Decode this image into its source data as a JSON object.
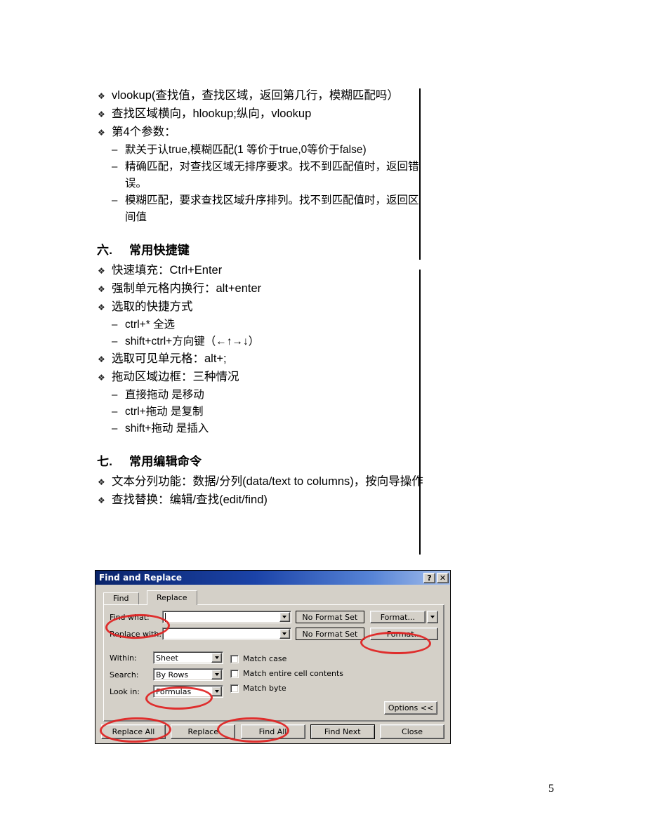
{
  "page": {
    "number": "5"
  },
  "document": {
    "list_top": [
      {
        "bullet": "❖",
        "text": "vlookup(查找值，查找区域，返回第几行，模糊匹配吗）"
      },
      {
        "bullet": "❖",
        "text": "查找区域横向，hlookup;纵向，vlookup"
      },
      {
        "bullet": "❖",
        "text": "第4个参数："
      }
    ],
    "sub_top": [
      {
        "bullet": "–",
        "text": "默关于认true,模糊匹配(1 等价于true,0等价于false)"
      },
      {
        "bullet": "–",
        "text": "精确匹配，对查找区域无排序要求。找不到匹配值时，返回错误。"
      },
      {
        "bullet": "–",
        "text": "模糊匹配，要求查找区域升序排列。找不到匹配值时，返回区间值"
      }
    ],
    "section_six": {
      "number": "六.",
      "title": "常用快捷键"
    },
    "list_six": [
      {
        "bullet": "❖",
        "text": "快速填充：Ctrl+Enter"
      },
      {
        "bullet": "❖",
        "text": "强制单元格内换行：alt+enter"
      },
      {
        "bullet": "❖",
        "text": "选取的快捷方式"
      }
    ],
    "sub_six_a": [
      {
        "bullet": "–",
        "text": "ctrl+*  全选"
      },
      {
        "bullet": "–",
        "text": "shift+ctrl+方向键（←↑→↓）"
      }
    ],
    "list_six_b": [
      {
        "bullet": "❖",
        "text": "选取可见单元格：alt+;"
      },
      {
        "bullet": "❖",
        "text": "拖动区域边框：三种情况"
      }
    ],
    "sub_six_b": [
      {
        "bullet": "–",
        "text": "直接拖动  是移动"
      },
      {
        "bullet": "–",
        "text": "ctrl+拖动  是复制"
      },
      {
        "bullet": "–",
        "text": "shift+拖动  是插入"
      }
    ],
    "section_seven": {
      "number": "七.",
      "title": "常用编辑命令"
    },
    "list_seven": [
      {
        "bullet": "❖",
        "text": "文本分列功能：数据/分列(data/text to columns)，按向导操作"
      },
      {
        "bullet": "❖",
        "text": "查找替换：编辑/查找(edit/find)"
      }
    ]
  },
  "dialog": {
    "title": "Find and Replace",
    "help_button": "?",
    "close_button": "✕",
    "tabs": [
      {
        "label": "Find",
        "active": false
      },
      {
        "label": "Replace",
        "active": true
      }
    ],
    "fields": {
      "find_what_label": "Find what:",
      "find_what_value": "",
      "replace_with_label": "Replace with:",
      "replace_with_value": "",
      "no_format_set_1": "No Format Set",
      "no_format_set_2": "No Format Set",
      "format_button_1": "Format...",
      "format_button_2": "Format..."
    },
    "selectors": {
      "within_label": "Within:",
      "within_value": "Sheet",
      "search_label": "Search:",
      "search_value": "By Rows",
      "look_in_label": "Look in:",
      "look_in_value": "Formulas"
    },
    "checkboxes": [
      {
        "label": "Match case",
        "checked": false
      },
      {
        "label": "Match entire cell contents",
        "checked": false
      },
      {
        "label": "Match byte",
        "checked": false
      }
    ],
    "options_button": "Options <<",
    "buttons": [
      {
        "label": "Replace All",
        "default": false
      },
      {
        "label": "Replace",
        "default": false
      },
      {
        "label": "Find All",
        "default": false
      },
      {
        "label": "Find Next",
        "default": true
      },
      {
        "label": "Close",
        "default": false
      }
    ],
    "annotation_color": "#e02020"
  }
}
